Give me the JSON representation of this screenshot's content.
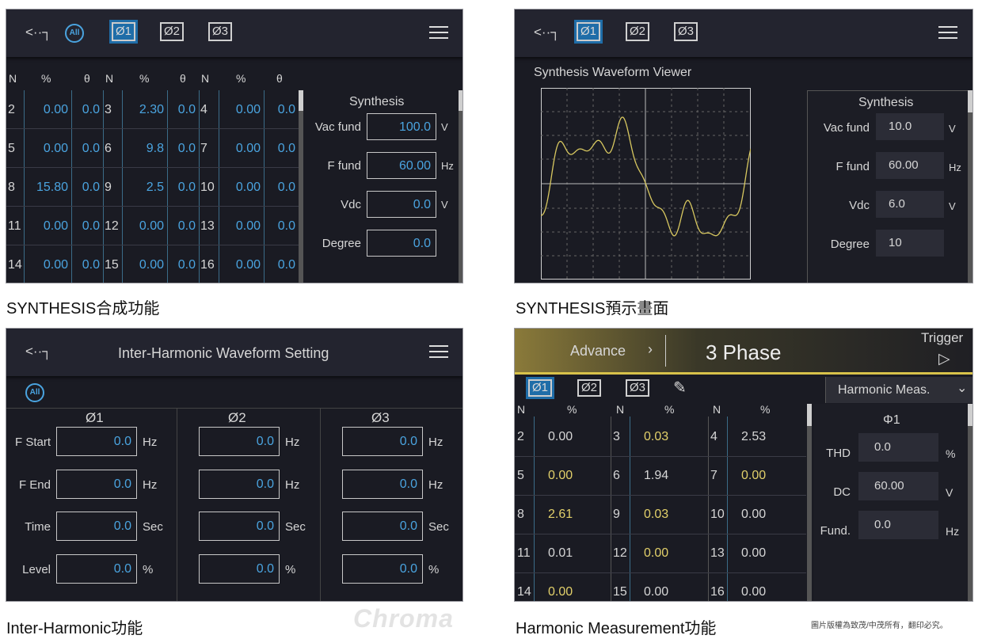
{
  "panel1": {
    "phase_all": "All",
    "phases": [
      "Ø1",
      "Ø2",
      "Ø3"
    ],
    "headers": [
      "N",
      "%",
      "θ",
      "N",
      "%",
      "θ",
      "N",
      "%",
      "θ"
    ],
    "rows": [
      [
        "2",
        "0.00",
        "0.0",
        "3",
        "2.30",
        "0.0",
        "4",
        "0.00",
        "0.0"
      ],
      [
        "5",
        "0.00",
        "0.0",
        "6",
        "9.8",
        "0.0",
        "7",
        "0.00",
        "0.0"
      ],
      [
        "8",
        "15.80",
        "0.0",
        "9",
        "2.5",
        "0.0",
        "10",
        "0.00",
        "0.0"
      ],
      [
        "11",
        "0.00",
        "0.0",
        "12",
        "0.00",
        "0.0",
        "13",
        "0.00",
        "0.0"
      ],
      [
        "14",
        "0.00",
        "0.0",
        "15",
        "0.00",
        "0.0",
        "16",
        "0.00",
        "0.0"
      ]
    ],
    "synth_title": "Synthesis",
    "fields": [
      {
        "label": "Vac fund",
        "value": "100.0",
        "unit": "V"
      },
      {
        "label": "F fund",
        "value": "60.00",
        "unit": "Hz"
      },
      {
        "label": "Vdc",
        "value": "0.0",
        "unit": "V"
      },
      {
        "label": "Degree",
        "value": "0.0",
        "unit": ""
      }
    ]
  },
  "panel2": {
    "phases": [
      "Ø1",
      "Ø2",
      "Ø3"
    ],
    "viewer_title": "Synthesis Waveform Viewer",
    "synth_title": "Synthesis",
    "fields": [
      {
        "label": "Vac fund",
        "value": "10.0",
        "unit": "V"
      },
      {
        "label": "F fund",
        "value": "60.00",
        "unit": "Hz"
      },
      {
        "label": "Vdc",
        "value": "6.0",
        "unit": "V"
      },
      {
        "label": "Degree",
        "value": "10",
        "unit": ""
      }
    ]
  },
  "panel3": {
    "title": "Inter-Harmonic Waveform Setting",
    "phase_all": "All",
    "cols": [
      "Ø1",
      "Ø2",
      "Ø3"
    ],
    "rows": [
      {
        "label": "F Start",
        "value": "0.0",
        "unit": "Hz"
      },
      {
        "label": "F End",
        "value": "0.0",
        "unit": "Hz"
      },
      {
        "label": "Time",
        "value": "0.0",
        "unit": "Sec"
      },
      {
        "label": "Level",
        "value": "0.0",
        "unit": "%"
      }
    ]
  },
  "panel4": {
    "advance": "Advance",
    "advance_arrow": "›",
    "mode": "3 Phase",
    "trigger": "Trigger",
    "trigger_icon": "▷",
    "phases": [
      "Ø1",
      "Ø2",
      "Ø3"
    ],
    "dropdown": "Harmonic Meas.",
    "dropdown_arrow": "⌄",
    "headers": [
      "N",
      "%",
      "N",
      "%",
      "N",
      "%"
    ],
    "rows": [
      [
        "2",
        "0.00",
        "3",
        "0.03",
        "4",
        "2.53"
      ],
      [
        "5",
        "0.00",
        "6",
        "1.94",
        "7",
        "0.00"
      ],
      [
        "8",
        "2.61",
        "9",
        "0.03",
        "10",
        "0.00"
      ],
      [
        "11",
        "0.01",
        "12",
        "0.00",
        "13",
        "0.00"
      ],
      [
        "14",
        "0.00",
        "15",
        "0.00",
        "16",
        "0.00"
      ]
    ],
    "yellow": [
      [
        0,
        1,
        0
      ],
      [
        1,
        0,
        1
      ],
      [
        1,
        1,
        0
      ],
      [
        0,
        1,
        0
      ],
      [
        1,
        0,
        0
      ]
    ],
    "side_title": "Φ1",
    "fields": [
      {
        "label": "THD",
        "value": "0.0",
        "unit": "%"
      },
      {
        "label": "DC",
        "value": "60.00",
        "unit": "V"
      },
      {
        "label": "Fund.",
        "value": "0.0",
        "unit": "Hz"
      }
    ]
  },
  "captions": {
    "c1": "SYNTHESIS合成功能",
    "c2": "SYNTHESIS預示畫面",
    "c3": "Inter-Harmonic功能",
    "c4": "Harmonic Measurement功能"
  },
  "brand": "Chroma",
  "copyright": "圖片版權為致茂/中茂所有，翻印必究。",
  "icons": {
    "back": "back-arrow-icon",
    "menu": "hamburger-menu-icon",
    "pen": "pen-icon"
  }
}
